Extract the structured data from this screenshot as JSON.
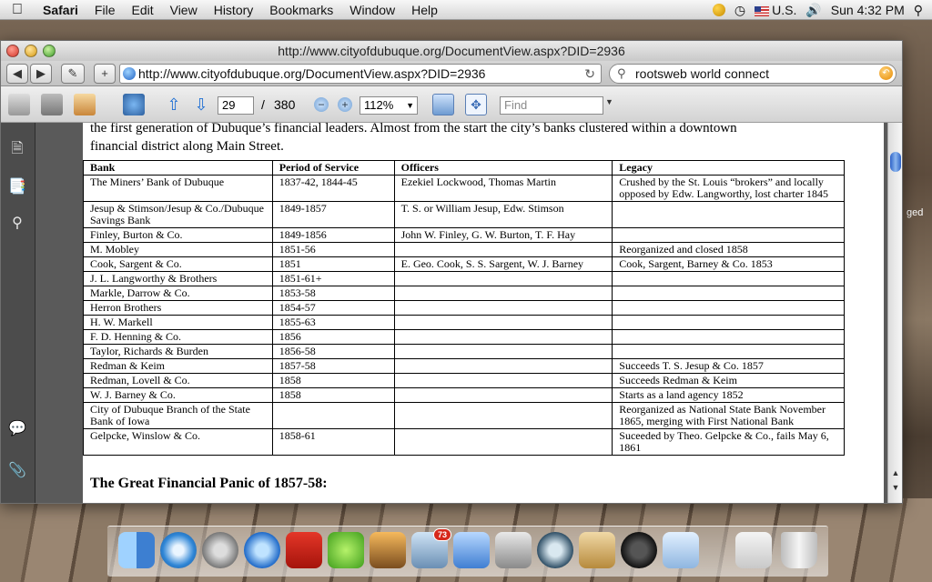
{
  "menubar": {
    "app": "Safari",
    "items": [
      "File",
      "Edit",
      "View",
      "History",
      "Bookmarks",
      "Window",
      "Help"
    ],
    "input_locale": "U.S.",
    "clock": "Sun 4:32 PM"
  },
  "window": {
    "title": "http://www.cityofdubuque.org/DocumentView.aspx?DID=2936",
    "url": "http://www.cityofdubuque.org/DocumentView.aspx?DID=2936",
    "search_query": "rootsweb world connect"
  },
  "pdf_toolbar": {
    "current_page": "29",
    "page_separator": "/",
    "total_pages": "380",
    "zoom": "112%",
    "find_placeholder": "Find"
  },
  "document": {
    "intro_line1": "the first generation of Dubuque’s financial leaders.  Almost from the start the city’s banks clustered within a downtown",
    "intro_line2": "financial district along Main Street.",
    "table": {
      "headers": [
        "Bank",
        "Period of Service",
        "Officers",
        "Legacy"
      ],
      "rows": [
        [
          "The Miners’ Bank of Dubuque",
          "1837-42, 1844-45",
          "Ezekiel Lockwood, Thomas Martin",
          "Crushed by the St. Louis “brokers” and locally opposed by Edw. Langworthy, lost charter 1845"
        ],
        [
          "Jesup & Stimson/Jesup & Co./Dubuque Savings Bank",
          "1849-1857",
          "T. S. or William Jesup, Edw. Stimson",
          ""
        ],
        [
          "Finley, Burton & Co.",
          "1849-1856",
          "John W. Finley, G. W. Burton, T. F. Hay",
          ""
        ],
        [
          "M. Mobley",
          "1851-56",
          "",
          "Reorganized and closed 1858"
        ],
        [
          "Cook, Sargent & Co.",
          "1851",
          "E. Geo. Cook, S. S. Sargent, W. J. Barney",
          "Cook, Sargent, Barney & Co. 1853"
        ],
        [
          "J. L. Langworthy & Brothers",
          "1851-61+",
          "",
          ""
        ],
        [
          "Markle, Darrow & Co.",
          "1853-58",
          "",
          ""
        ],
        [
          "Herron Brothers",
          "1854-57",
          "",
          ""
        ],
        [
          "H. W. Markell",
          "1855-63",
          "",
          ""
        ],
        [
          "F. D. Henning & Co.",
          "1856",
          "",
          ""
        ],
        [
          "Taylor, Richards & Burden",
          "1856-58",
          "",
          ""
        ],
        [
          "Redman & Keim",
          "1857-58",
          "",
          "Succeeds T. S. Jesup & Co. 1857"
        ],
        [
          "Redman, Lovell & Co.",
          "1858",
          "",
          "Succeeds Redman & Keim"
        ],
        [
          "W. J. Barney & Co.",
          "1858",
          "",
          "Starts as a land agency 1852"
        ],
        [
          "City of Dubuque Branch of the State Bank of Iowa",
          "",
          "",
          "Reorganized as National State Bank November 1865, merging with First National Bank"
        ],
        [
          "Gelpcke, Winslow & Co.",
          "1858-61",
          "",
          "Suceeded by Theo. Gelpcke & Co., fails May 6, 1861"
        ]
      ]
    },
    "heading": "The Great Financial Panic of 1857-58:"
  },
  "dock": {
    "mail_badge": "73",
    "apps": [
      "finder-icon",
      "safari-icon",
      "system-preferences-icon",
      "itunes-icon",
      "acrobat-icon",
      "network-icon",
      "iphoto-icon",
      "mail-icon",
      "word-icon",
      "printer-icon",
      "time-machine-icon",
      "address-book-icon",
      "dashboard-icon",
      "preview-icon",
      "documents-stack-icon",
      "trash-icon"
    ]
  },
  "desktop": {
    "edge_label": "ged"
  }
}
